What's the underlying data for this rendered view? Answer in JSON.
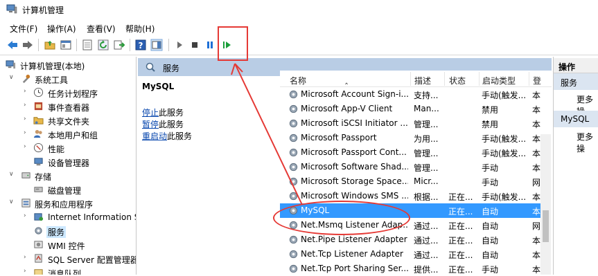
{
  "window": {
    "title": "计算机管理"
  },
  "menu": [
    "文件(F)",
    "操作(A)",
    "查看(V)",
    "帮助(H)"
  ],
  "toolbar": {
    "icons": [
      "back-icon",
      "forward-icon",
      "up-folder-icon",
      "show-hide-tree-icon",
      "properties-icon",
      "refresh-icon",
      "export-icon",
      "help-icon",
      "show-action-pane-icon",
      "play-icon",
      "stop-icon",
      "pause-icon",
      "resume-icon"
    ],
    "colors": {
      "play": "#6d6d6d",
      "stop": "#404040",
      "pause": "#1e6fd6",
      "resume": "#1a9e3a"
    }
  },
  "tree": {
    "root": "计算机管理(本地)",
    "system_tools": "系统工具",
    "task_scheduler": "任务计划程序",
    "event_viewer": "事件查看器",
    "shared_folders": "共享文件夹",
    "local_users": "本地用户和组",
    "performance": "性能",
    "device_manager": "设备管理器",
    "storage": "存储",
    "disk_management": "磁盘管理",
    "services_apps": "服务和应用程序",
    "iis": "Internet Information S",
    "services": "服务",
    "wmi": "WMI 控件",
    "sql_config": "SQL Server 配置管理器",
    "message_queue": "消息队列"
  },
  "center": {
    "header": "服务",
    "detail": {
      "name": "MySQL",
      "stop_link": "停止",
      "stop_rest": "此服务",
      "pause_link": "暂停",
      "pause_rest": "此服务",
      "restart_link": "重启动",
      "restart_rest": "此服务"
    },
    "columns": {
      "name": "名称",
      "desc": "描述",
      "status": "状态",
      "startup": "启动类型",
      "logon": "登"
    },
    "rows": [
      {
        "name": "Microsoft Account Sign-i...",
        "desc": "支持...",
        "status": "",
        "startup": "手动(触发...",
        "logon": "本"
      },
      {
        "name": "Microsoft App-V Client",
        "desc": "Man...",
        "status": "",
        "startup": "禁用",
        "logon": "本"
      },
      {
        "name": "Microsoft iSCSI Initiator ...",
        "desc": "管理...",
        "status": "",
        "startup": "禁用",
        "logon": "本"
      },
      {
        "name": "Microsoft Passport",
        "desc": "为用...",
        "status": "",
        "startup": "手动(触发...",
        "logon": "本"
      },
      {
        "name": "Microsoft Passport Cont...",
        "desc": "管理...",
        "status": "",
        "startup": "手动(触发...",
        "logon": "本"
      },
      {
        "name": "Microsoft Software Shad...",
        "desc": "管理...",
        "status": "",
        "startup": "手动",
        "logon": "本"
      },
      {
        "name": "Microsoft Storage Space...",
        "desc": "Micr...",
        "status": "",
        "startup": "手动",
        "logon": "网"
      },
      {
        "name": "Microsoft Windows SMS ...",
        "desc": "根据...",
        "status": "正在...",
        "startup": "手动(触发...",
        "logon": "本"
      },
      {
        "name": "MySQL",
        "desc": "",
        "status": "正在...",
        "startup": "自动",
        "logon": "本"
      },
      {
        "name": "Net.Msmq Listener Adap...",
        "desc": "通过...",
        "status": "正在...",
        "startup": "自动",
        "logon": "网"
      },
      {
        "name": "Net.Pipe Listener Adapter",
        "desc": "通过...",
        "status": "正在...",
        "startup": "自动",
        "logon": "本"
      },
      {
        "name": "Net.Tcp Listener Adapter",
        "desc": "通过...",
        "status": "正在...",
        "startup": "自动",
        "logon": "本"
      },
      {
        "name": "Net.Tcp Port Sharing Ser...",
        "desc": "提供...",
        "status": "正在...",
        "startup": "手动",
        "logon": "本"
      }
    ],
    "selected_index": 8
  },
  "actions": {
    "header": "操作",
    "section1": "服务",
    "more1": "更多操",
    "section2": "MySQL",
    "more2": "更多操"
  },
  "annotation_color": "#e53935"
}
